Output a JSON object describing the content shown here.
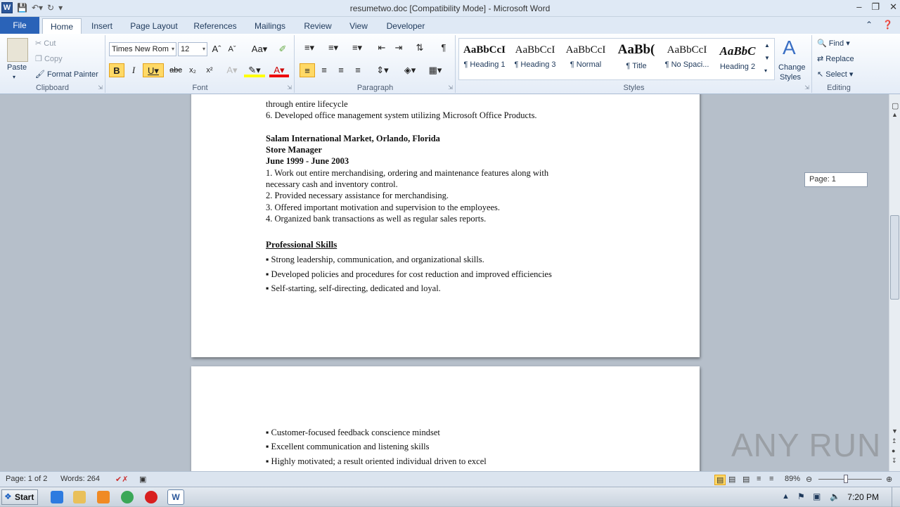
{
  "window": {
    "title": "resumetwo.doc [Compatibility Mode]  -  Microsoft Word"
  },
  "tabs": [
    "File",
    "Home",
    "Insert",
    "Page Layout",
    "References",
    "Mailings",
    "Review",
    "View",
    "Developer"
  ],
  "clipboard": {
    "paste": "Paste",
    "cut": "Cut",
    "copy": "Copy",
    "format_painter": "Format Painter",
    "label": "Clipboard"
  },
  "font": {
    "family": "Times New Rom",
    "size": "12",
    "label": "Font"
  },
  "paragraph": {
    "label": "Paragraph"
  },
  "styles": {
    "label": "Styles",
    "change": "Change",
    "change2": "Styles",
    "items": [
      {
        "preview": "AaBbCcI",
        "name": "¶ Heading 1"
      },
      {
        "preview": "AaBbCcI",
        "name": "¶ Heading 3"
      },
      {
        "preview": "AaBbCcI",
        "name": "¶ Normal"
      },
      {
        "preview": "AaBb(",
        "name": "¶ Title"
      },
      {
        "preview": "AaBbCcI",
        "name": "¶ No Spaci..."
      },
      {
        "preview": "AaBbC",
        "name": "Heading 2"
      }
    ]
  },
  "editing": {
    "find": "Find",
    "replace": "Replace",
    "select": "Select",
    "label": "Editing"
  },
  "page_indicator": "Page: 1",
  "document": {
    "page1": [
      "through entire lifecycle",
      "6. Developed  office management system utilizing  Microsoft Office Products.",
      "Salam International Market, Orlando, Florida",
      "Store Manager",
      "June 1999 - June 2003",
      "1. Work out entire merchandising, ordering and maintenance features along with",
      "necessary cash and inventory  control.",
      "2. Provided necessary assistance for merchandising.",
      "3. Offered important motivation  and supervision to the employees.",
      "4. Organized  bank transactions as well as regular  sales reports.",
      "Professional Skills",
      "▪ Strong leadership,  communication, and organizational  skills.",
      "▪ Developed  policies  and procedures for cost reduction and improved  efficiencies",
      "▪ Self-starting,  self-directing, dedicated and loyal."
    ],
    "page2": [
      "▪ Customer-focused feedback conscience mindset",
      "▪ Excellent  communication and listening  skills",
      "▪ Highly  motivated; a result oriented individual  driven to excel"
    ]
  },
  "status": {
    "page": "Page: 1 of 2",
    "words": "Words: 264",
    "zoom": "89%"
  },
  "taskbar": {
    "start": "Start",
    "clock": "7:20 PM"
  },
  "watermark": "ANY RUN"
}
